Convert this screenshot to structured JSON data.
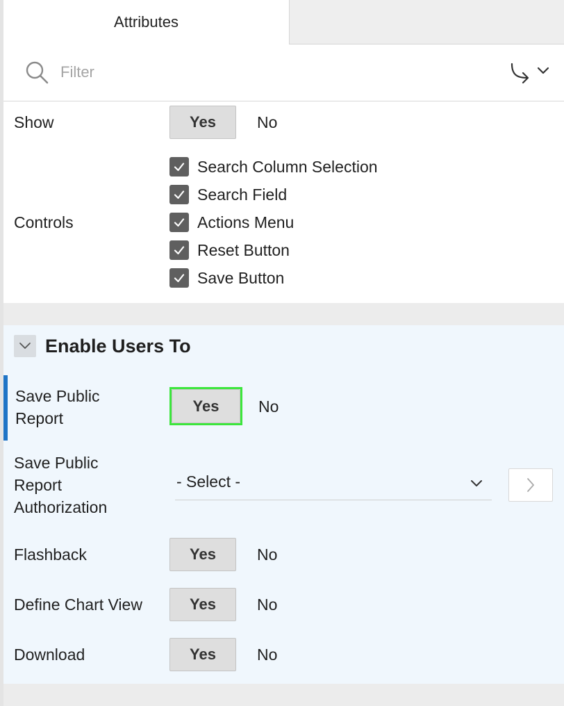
{
  "tabs": [
    {
      "label": "Attributes"
    }
  ],
  "filter": {
    "placeholder": "Filter"
  },
  "display": {
    "show": {
      "label": "Show",
      "yes": "Yes",
      "no": "No"
    },
    "controls": {
      "label": "Controls",
      "items": [
        {
          "label": "Search Column Selection",
          "checked": true
        },
        {
          "label": "Search Field",
          "checked": true
        },
        {
          "label": "Actions Menu",
          "checked": true
        },
        {
          "label": "Reset Button",
          "checked": true
        },
        {
          "label": "Save Button",
          "checked": true
        }
      ]
    }
  },
  "enable_users": {
    "title": "Enable Users To",
    "save_public_report": {
      "label_line1": "Save Public",
      "label_line2": "Report",
      "yes": "Yes",
      "no": "No"
    },
    "authorization": {
      "label_line1": "Save Public",
      "label_line2": "Report",
      "label_line3": "Authorization",
      "select_value": "- Select -"
    },
    "flashback": {
      "label": "Flashback",
      "yes": "Yes",
      "no": "No"
    },
    "define_chart_view": {
      "label": "Define Chart View",
      "yes": "Yes",
      "no": "No"
    },
    "download": {
      "label": "Download",
      "yes": "Yes",
      "no": "No"
    }
  },
  "colors": {
    "accent": "#1f74c6",
    "highlight": "#3ce63c",
    "section_bg": "#f0f7fd",
    "toggle_bg": "#dedede"
  }
}
